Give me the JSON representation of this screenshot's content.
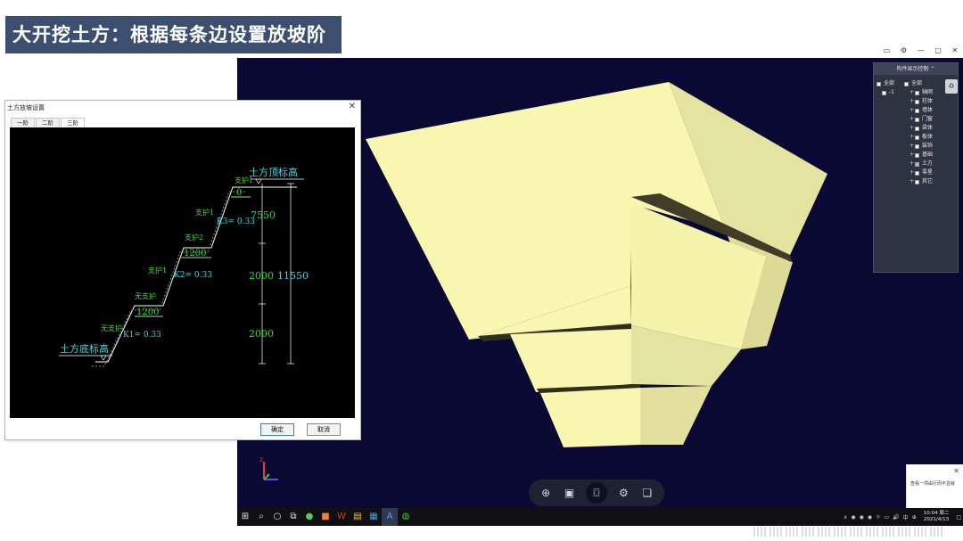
{
  "slide": {
    "title": "大开挖土方：根据每条边设置放坡阶数"
  },
  "window_controls": [
    "▭",
    "⚙",
    "—",
    "▢",
    "✕"
  ],
  "component_panel": {
    "header": "构件显示控制 ⌃",
    "left_tree": [
      {
        "label": "全部",
        "checked": true
      },
      {
        "label": "-1",
        "checked": true
      }
    ],
    "right_tree": [
      {
        "label": "全部",
        "checked": false,
        "expand": false
      },
      {
        "label": "轴网",
        "checked": false,
        "expand": true
      },
      {
        "label": "柱体",
        "checked": false,
        "expand": true
      },
      {
        "label": "墙体",
        "checked": false,
        "expand": true
      },
      {
        "label": "门窗",
        "checked": false,
        "expand": true
      },
      {
        "label": "梁体",
        "checked": false,
        "expand": true
      },
      {
        "label": "板体",
        "checked": false,
        "expand": true
      },
      {
        "label": "装饰",
        "checked": false,
        "expand": true
      },
      {
        "label": "基础",
        "checked": false,
        "expand": true
      },
      {
        "label": "土方",
        "checked": true,
        "expand": true
      },
      {
        "label": "零星",
        "checked": false,
        "expand": true
      },
      {
        "label": "其它",
        "checked": false,
        "expand": true
      }
    ]
  },
  "dialog": {
    "title": "土方放坡设置",
    "close": "✕",
    "tabs": [
      "一阶",
      "二阶",
      "三阶"
    ],
    "active_tab": 2,
    "ok": "确定",
    "cancel": "取消",
    "drawing": {
      "top_label": "土方顶标高",
      "bottom_label": "土方底标高",
      "supports": [
        "支护1",
        "支护1",
        "支护2",
        "支护1",
        "无支护",
        "无支护"
      ],
      "berms": [
        "0",
        "1200",
        "1200"
      ],
      "slopes": [
        "K3= 0.33",
        "K2= 0.33",
        "K1= 0.33"
      ],
      "heights": [
        "7550",
        "2000",
        "2000"
      ],
      "total_height": "11550"
    }
  },
  "view_toolbar": [
    {
      "name": "globe-icon",
      "glyph": "⊕"
    },
    {
      "name": "cube-view-icon",
      "glyph": "▣"
    },
    {
      "name": "camera-icon",
      "glyph": "⌼"
    },
    {
      "name": "gear-icon",
      "glyph": "⚙"
    },
    {
      "name": "clipboard-icon",
      "glyph": "❏"
    }
  ],
  "axis_labels": {
    "z": "Z"
  },
  "notification": {
    "text": "查看一项由行而不显就",
    "close": "✕"
  },
  "taskbar": {
    "tray_items": [
      "∧",
      "◉",
      "◉",
      "◉",
      "☼",
      "▭",
      "🔊",
      "中",
      "⊕",
      "□"
    ],
    "clock_time": "10:04 周二",
    "clock_date": "2021/4/13"
  },
  "colors": {
    "viewport_bg": "#090933",
    "model_fill": "#f8f6b0",
    "title_bg": "#3d4f6f"
  }
}
